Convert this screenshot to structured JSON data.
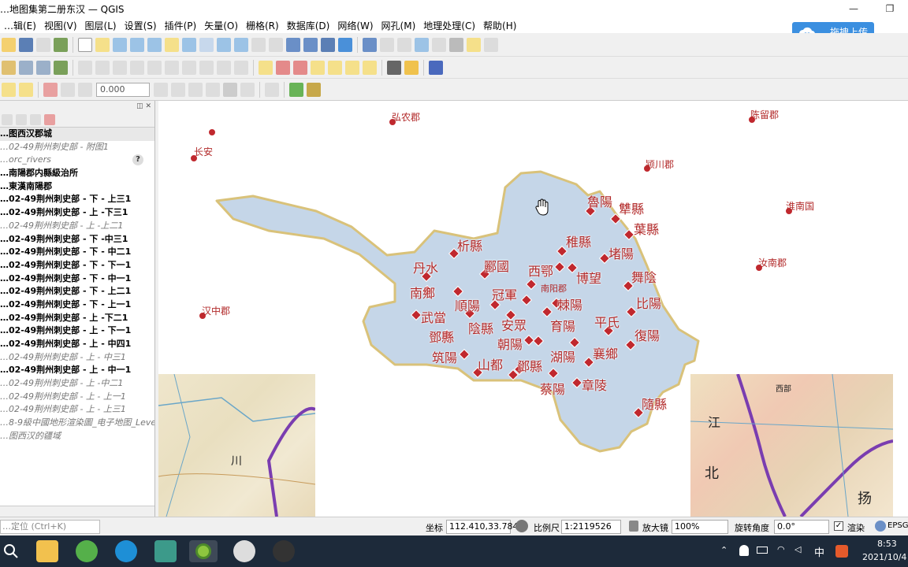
{
  "window": {
    "title": "…地图集第二册东汉 — QGIS",
    "minimize": "—",
    "restore": "❐"
  },
  "menu": [
    "…辑(E)",
    "视图(V)",
    "图层(L)",
    "设置(S)",
    "插件(P)",
    "矢量(O)",
    "栅格(R)",
    "数据库(D)",
    "网络(W)",
    "网孔(M)",
    "地理处理(C)",
    "帮助(H)"
  ],
  "toolbar": {
    "spin_value": "0.000",
    "upload_label": "拖拽上传"
  },
  "layers": [
    {
      "label": "…图西汉郡城",
      "style": "bold selected"
    },
    {
      "label": "…02-49荆州刺史部 - 附图1",
      "style": "italic"
    },
    {
      "label": "…orc_rivers",
      "style": "italic",
      "badge": "?"
    },
    {
      "label": "…南陽郡内縣級治所",
      "style": "bold"
    },
    {
      "label": "…東漢南陽郡",
      "style": "bold"
    },
    {
      "label": "…02-49荆州刺史部 - 下 - 上三1",
      "style": "bold"
    },
    {
      "label": "…02-49荆州刺史部 - 上 -下三1",
      "style": "bold"
    },
    {
      "label": "…02-49荆州刺史部 - 上 -上二1",
      "style": "italic"
    },
    {
      "label": "…02-49荆州刺史部 - 下 -中三1",
      "style": "bold"
    },
    {
      "label": "…02-49荆州刺史部 - 下 - 中二1",
      "style": "bold"
    },
    {
      "label": "…02-49荆州刺史部 - 下 - 下一1",
      "style": "bold"
    },
    {
      "label": "…02-49荆州刺史部 - 下 - 中一1",
      "style": "bold"
    },
    {
      "label": "…02-49荆州刺史部 - 下 - 上二1",
      "style": "bold"
    },
    {
      "label": "…02-49荆州刺史部 - 下 - 上一1",
      "style": "bold"
    },
    {
      "label": "…02-49荆州刺史部 - 上 -下二1",
      "style": "bold"
    },
    {
      "label": "…02-49荆州刺史部 - 上 - 下一1",
      "style": "bold"
    },
    {
      "label": "…02-49荆州刺史部 - 上 - 中四1",
      "style": "bold"
    },
    {
      "label": "…02-49荆州刺史部 - 上 - 中三1",
      "style": "italic"
    },
    {
      "label": "…02-49荆州刺史部 - 上 - 中一1",
      "style": "bold"
    },
    {
      "label": "…02-49荆州刺史部 - 上 -中二1",
      "style": "italic"
    },
    {
      "label": "…02-49荆州刺史部 - 上 - 上一1",
      "style": "italic"
    },
    {
      "label": "…02-49荆州刺史部 - 上 - 上三1",
      "style": "italic"
    },
    {
      "label": "…8-9級中國地形渲染圖_电子地图_Leve…",
      "style": "italic"
    },
    {
      "label": "…图西汉的疆域",
      "style": "italic"
    }
  ],
  "map": {
    "outer_labels": [
      {
        "text": "弘农郡"
      },
      {
        "text": "陈留郡"
      },
      {
        "text": "长安"
      },
      {
        "text": "颍川郡"
      },
      {
        "text": "淮南国"
      },
      {
        "text": "汝南郡"
      },
      {
        "text": "汉中郡"
      }
    ],
    "county_labels": [
      {
        "text": "魯陽"
      },
      {
        "text": "犨縣"
      },
      {
        "text": "葉縣"
      },
      {
        "text": "稚縣"
      },
      {
        "text": "堵陽"
      },
      {
        "text": "析縣"
      },
      {
        "text": "丹水"
      },
      {
        "text": "酈國"
      },
      {
        "text": "西鄂"
      },
      {
        "text": "博望"
      },
      {
        "text": "舞陰"
      },
      {
        "text": "南鄉"
      },
      {
        "text": "順陽"
      },
      {
        "text": "冠軍"
      },
      {
        "text": "棘陽"
      },
      {
        "text": "比陽"
      },
      {
        "text": "武當"
      },
      {
        "text": "陰縣"
      },
      {
        "text": "安眾"
      },
      {
        "text": "育陽"
      },
      {
        "text": "平氏"
      },
      {
        "text": "鄧縣"
      },
      {
        "text": "朝陽"
      },
      {
        "text": "復陽"
      },
      {
        "text": "筑陽"
      },
      {
        "text": "湖陽"
      },
      {
        "text": "襄鄉"
      },
      {
        "text": "山都"
      },
      {
        "text": "鄧縣"
      },
      {
        "text": "蔡陽"
      },
      {
        "text": "章陵"
      },
      {
        "text": "隨縣"
      }
    ],
    "small_label": "南阳郡",
    "raster_left_label": "川",
    "raster_right_labels": [
      "江",
      "北",
      "扬",
      "西部"
    ]
  },
  "statusbar": {
    "locator_placeholder": "…定位 (Ctrl+K)",
    "coord_label": "坐标",
    "coord_value": "112.410,33.784",
    "scale_label": "比例尺",
    "scale_value": "1:2119526",
    "magnifier_label": "放大镜",
    "magnifier_value": "100%",
    "rotation_label": "旋转角度",
    "rotation_value": "0.0°",
    "render_label": "渲染",
    "crs_label": "EPSG:…"
  },
  "taskbar": {
    "ime": "中",
    "time": "8:53",
    "date": "2021/10/4"
  },
  "colors": {
    "polygon_fill": "#c5d6e8",
    "polygon_stroke": "#d9c27a",
    "marker": "#c0282e",
    "label": "#b22a2a"
  }
}
